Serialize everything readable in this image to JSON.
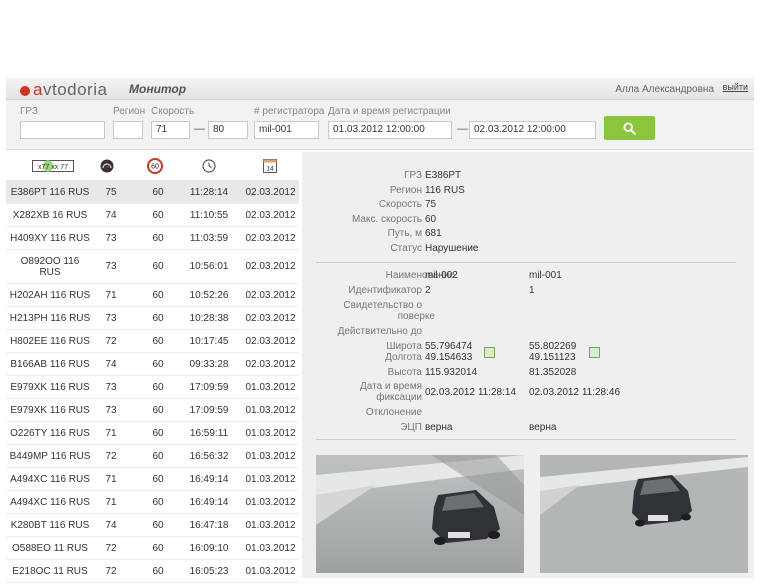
{
  "header": {
    "logo_prefix": "a",
    "logo_rest": "vtodoria",
    "app_name": "Монитор",
    "user_name": "Алла Александровна",
    "logout_label": "выйти"
  },
  "filters": {
    "plate_label": "ГРЗ",
    "plate_value": "",
    "region_label": "Регион",
    "region_value": "",
    "speed_label": "Скорость",
    "speed_from": "71",
    "speed_to": "80",
    "registrator_label": "# регистратора",
    "registrator_value": "mil-001",
    "datetime_label": "Дата и время регистрации",
    "datetime_from": "01.03.2012 12:00:00",
    "datetime_to": "02.03.2012 12:00:00",
    "range_dash": "—"
  },
  "list": {
    "header_icons": [
      "license-plate-icon",
      "speedometer-icon",
      "speed-limit-sign-icon",
      "clock-icon",
      "calendar-icon"
    ],
    "plate_icon_text": "x77 xx 77",
    "limit_icon_text": "60",
    "calendar_icon_text": "14",
    "rows": [
      {
        "plate": "E386PT 116 RUS",
        "speed": "75",
        "limit": "60",
        "time": "11:28:14",
        "date": "02.03.2012"
      },
      {
        "plate": "X282XB 16 RUS",
        "speed": "74",
        "limit": "60",
        "time": "11:10:55",
        "date": "02.03.2012"
      },
      {
        "plate": "H409XY 116 RUS",
        "speed": "73",
        "limit": "60",
        "time": "11:03:59",
        "date": "02.03.2012"
      },
      {
        "plate": "O892OO 116 RUS",
        "speed": "73",
        "limit": "60",
        "time": "10:56:01",
        "date": "02.03.2012"
      },
      {
        "plate": "H202AH 116 RUS",
        "speed": "71",
        "limit": "60",
        "time": "10:52:26",
        "date": "02.03.2012"
      },
      {
        "plate": "H213PH 116 RUS",
        "speed": "73",
        "limit": "60",
        "time": "10:28:38",
        "date": "02.03.2012"
      },
      {
        "plate": "H802EE 116 RUS",
        "speed": "72",
        "limit": "60",
        "time": "10:17:45",
        "date": "02.03.2012"
      },
      {
        "plate": "B166AB 116 RUS",
        "speed": "74",
        "limit": "60",
        "time": "09:33:28",
        "date": "02.03.2012"
      },
      {
        "plate": "E979XK 116 RUS",
        "speed": "73",
        "limit": "60",
        "time": "17:09:59",
        "date": "01.03.2012"
      },
      {
        "plate": "E979XK 116 RUS",
        "speed": "73",
        "limit": "60",
        "time": "17:09:59",
        "date": "01.03.2012"
      },
      {
        "plate": "O226TY 116 RUS",
        "speed": "71",
        "limit": "60",
        "time": "16:59:11",
        "date": "01.03.2012"
      },
      {
        "plate": "B449MP 116 RUS",
        "speed": "72",
        "limit": "60",
        "time": "16:56:32",
        "date": "01.03.2012"
      },
      {
        "plate": "A494XC 116 RUS",
        "speed": "71",
        "limit": "60",
        "time": "16:49:14",
        "date": "01.03.2012"
      },
      {
        "plate": "A494XC 116 RUS",
        "speed": "71",
        "limit": "60",
        "time": "16:49:14",
        "date": "01.03.2012"
      },
      {
        "plate": "K280BT 116 RUS",
        "speed": "74",
        "limit": "60",
        "time": "16:47:18",
        "date": "01.03.2012"
      },
      {
        "plate": "O588EO 11 RUS",
        "speed": "72",
        "limit": "60",
        "time": "16:09:10",
        "date": "01.03.2012"
      },
      {
        "plate": "E218OC 11 RUS",
        "speed": "72",
        "limit": "60",
        "time": "16:05:23",
        "date": "01.03.2012"
      }
    ]
  },
  "detail": {
    "summary": [
      {
        "key": "ГРЗ",
        "value": "E386PT"
      },
      {
        "key": "Регион",
        "value": "116 RUS"
      },
      {
        "key": "Скорость",
        "value": "75"
      },
      {
        "key": "Макс. скорость",
        "value": "60"
      },
      {
        "key": "Путь, м",
        "value": "681"
      },
      {
        "key": "Статус",
        "value": "Нарушение"
      }
    ],
    "fields": {
      "name_label": "Наименование",
      "name_1": "mil-002",
      "name_2": "mil-001",
      "id_label": "Идентификатор",
      "id_1": "2",
      "id_2": "1",
      "cert_label_1": "Свидетельство о",
      "cert_label_2": "поверке",
      "valid_label": "Действительно до",
      "lat_label": "Широта",
      "lat_1": "55.796474",
      "lat_2": "55.802269",
      "lon_label": "Долгота",
      "lon_1": "49.154633",
      "lon_2": "49.151123",
      "alt_label": "Высота",
      "alt_1": "115.932014",
      "alt_2": "81.352028",
      "fix_label_1": "Дата и время",
      "fix_label_2": "фиксации",
      "fix_1": "02.03.2012 11:28:14",
      "fix_2": "02.03.2012 11:28:46",
      "dev_label": "Отклонение",
      "sig_label": "ЭЦП",
      "sig_1": "верна",
      "sig_2": "верна"
    }
  },
  "colors": {
    "brand_red": "#d6311f",
    "search_green": "#8cc63f",
    "selected_row": "#e8e8e8",
    "panel_bg": "#efefef"
  }
}
